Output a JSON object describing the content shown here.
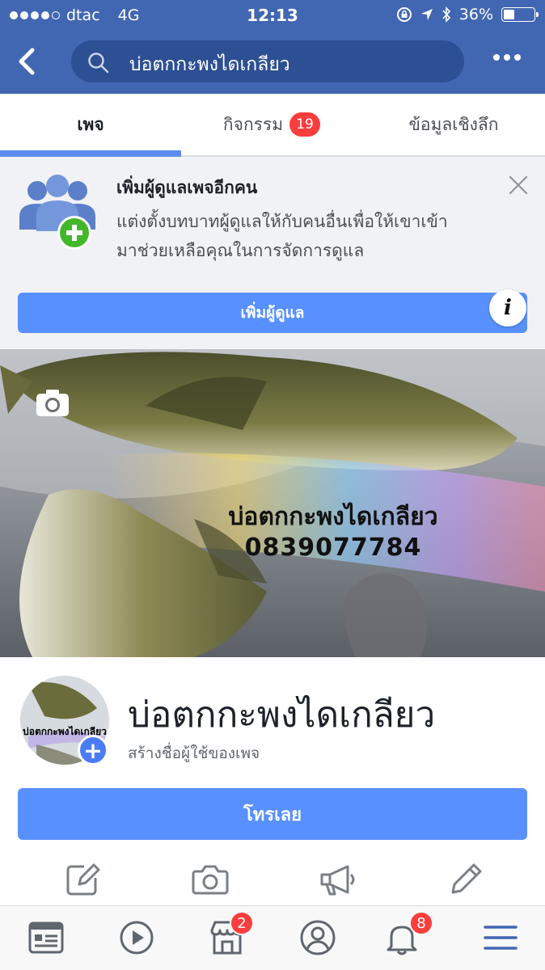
{
  "status_bar": {
    "carrier": "dtac",
    "network": "4G",
    "time": "12:13",
    "battery": "36%",
    "battery_level": 0.36
  },
  "nav": {
    "search_text": "บ่อตกกะพงไดเกลียว",
    "icons": [
      "back-icon",
      "search-icon",
      "more-icon"
    ]
  },
  "tabs": [
    {
      "label": "เพจ",
      "active": true
    },
    {
      "label": "กิจกรรม",
      "badge": "19"
    },
    {
      "label": "ข้อมูลเชิงลึก"
    }
  ],
  "admin_card": {
    "title": "เพิ่มผู้ดูแลเพจอีกคน",
    "desc_line1": "แต่งตั้งบทบาทผู้ดูแลให้กับคนอื่นเพื่อให้เขาเข้า",
    "desc_line2": "มาช่วยเหลือคุณในการจัดการดูแล",
    "button": "เพิ่มผู้ดูแล"
  },
  "cover": {
    "name": "บ่อตกกะพงไดเกลียว",
    "phone": "0839077784"
  },
  "profile": {
    "avatar_text": "บ่อตกกะพงไดเกลียว",
    "page_name": "บ่อตกกะพงไดเกลียว",
    "username_link": "สร้างชื่อผู้ใช้ของเพจ"
  },
  "call_button": "โทรเลย",
  "actions": [
    "edit-post-icon",
    "camera-icon",
    "megaphone-icon",
    "pencil-icon"
  ],
  "bottom_bar": {
    "items": [
      "news-feed-icon",
      "watch-icon",
      "marketplace-icon",
      "profile-icon",
      "notifications-icon",
      "menu-icon"
    ],
    "marketplace_badge": "2",
    "notifications_badge": "8"
  },
  "colors": {
    "header": "#4267b2",
    "accent": "#5890ff",
    "badge": "#fa3e3e"
  }
}
